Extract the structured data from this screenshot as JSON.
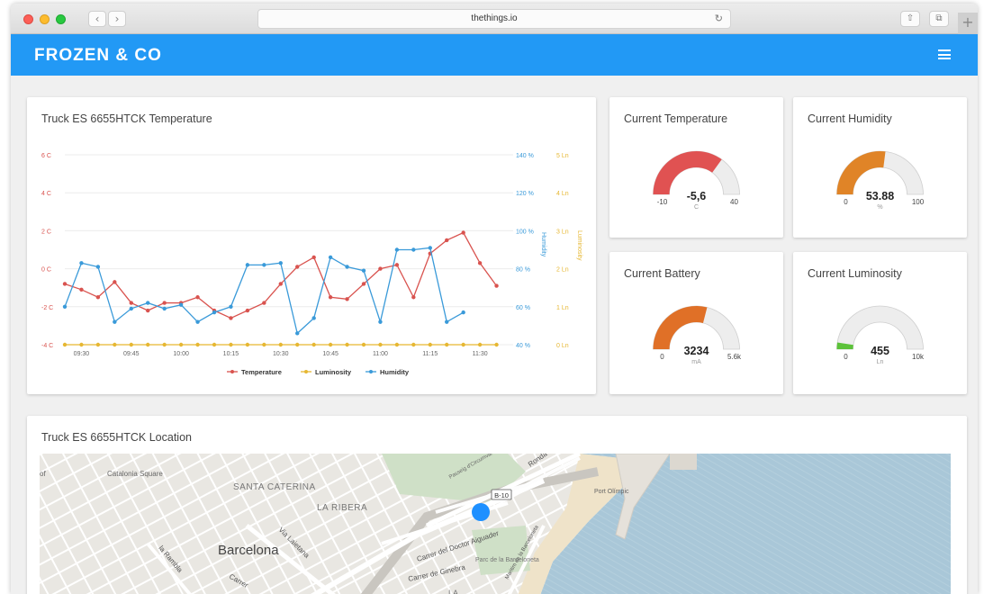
{
  "browser": {
    "url": "thethings.io",
    "back_icon": "‹",
    "forward_icon": "›",
    "reload_icon": "↻",
    "share_icon": "⇧",
    "tabs_icon": "⧉",
    "newtab_icon": "+"
  },
  "app": {
    "brand": "FROZEN & CO",
    "menu_icon": "hamburger-menu-icon",
    "accent_color": "#2299f5"
  },
  "temperature_chart": {
    "title": "Truck ES 6655HTCK Temperature"
  },
  "chart_data": {
    "type": "line",
    "x": [
      "09:25",
      "09:30",
      "09:35",
      "09:40",
      "09:45",
      "09:50",
      "09:55",
      "10:00",
      "10:05",
      "10:10",
      "10:15",
      "10:20",
      "10:25",
      "10:30",
      "10:35",
      "10:40",
      "10:45",
      "10:50",
      "10:55",
      "11:00",
      "11:05",
      "11:10",
      "11:15",
      "11:20",
      "11:25",
      "11:30",
      "11:35",
      "11:40"
    ],
    "x_tick_labels": [
      "09:30",
      "09:45",
      "10:00",
      "10:15",
      "10:30",
      "10:45",
      "11:00",
      "11:15",
      "11:30"
    ],
    "y_left": {
      "ticks": [
        "6 C",
        "4 C",
        "2 C",
        "0 C",
        "-2 C",
        "-4 C"
      ],
      "ylim": [
        -4,
        6
      ]
    },
    "y_right_humidity": {
      "label": "Humidity",
      "ticks": [
        "140 %",
        "120 %",
        "100 %",
        "80 %",
        "60 %",
        "40 %"
      ],
      "ylim": [
        40,
        140
      ]
    },
    "y_right_luminosity": {
      "label": "Luminosity",
      "ticks": [
        "5 Ln",
        "4 Ln",
        "3 Ln",
        "2 Ln",
        "1 Ln",
        "0 Ln"
      ],
      "ylim": [
        0,
        5
      ]
    },
    "series": [
      {
        "name": "Temperature",
        "color": "#d9534f",
        "axis": "left",
        "values": [
          -0.8,
          -1.1,
          -1.5,
          -0.7,
          -1.8,
          -2.2,
          -1.8,
          -1.8,
          -1.5,
          -2.2,
          -2.6,
          -2.2,
          -1.8,
          -0.8,
          0.1,
          0.6,
          -1.5,
          -1.6,
          -0.8,
          0.0,
          0.2,
          -1.5,
          0.8,
          1.5,
          1.9,
          0.3,
          -0.9,
          null
        ]
      },
      {
        "name": "Luminosity",
        "color": "#e6b732",
        "axis": "luminosity",
        "values": [
          0,
          0,
          0,
          0,
          0,
          0,
          0,
          0,
          0,
          0,
          0,
          0,
          0,
          0,
          0,
          0,
          0,
          0,
          0,
          0,
          0,
          0,
          0,
          0,
          0,
          0,
          0,
          null
        ]
      },
      {
        "name": "Humidity",
        "color": "#3a9ad9",
        "axis": "humidity",
        "values": [
          60,
          83,
          81,
          52,
          59,
          62,
          59,
          61,
          52,
          57,
          60,
          82,
          82,
          83,
          46,
          54,
          86,
          81,
          79,
          52,
          90,
          90,
          91,
          52,
          57,
          null,
          null,
          null
        ]
      }
    ],
    "legend": [
      "Temperature",
      "Luminosity",
      "Humidity"
    ]
  },
  "gauges": [
    {
      "title": "Current Temperature",
      "value": "-5,6",
      "unit": "C",
      "min": "-10",
      "max": "40",
      "fraction": 0.7,
      "color": "#e05252"
    },
    {
      "title": "Current Humidity",
      "value": "53.88",
      "unit": "%",
      "min": "0",
      "max": "100",
      "fraction": 0.54,
      "color": "#e08427"
    },
    {
      "title": "Current Battery",
      "value": "3234",
      "unit": "mA",
      "min": "0",
      "max": "5.6k",
      "fraction": 0.58,
      "color": "#e07027"
    },
    {
      "title": "Current Luminosity",
      "value": "455",
      "unit": "Ln",
      "min": "0",
      "max": "10k",
      "fraction": 0.05,
      "color": "#5cc23a"
    }
  ],
  "location": {
    "title": "Truck ES 6655HTCK Location",
    "labels": {
      "catalonia_square": "Catalonia Square",
      "santa_caterina": "SANTA CATERINA",
      "la_ribera": "LA RIBERA",
      "barcelona": "Barcelona",
      "via_laietana": "Via Laietana",
      "la_rambla": "la Rambla",
      "carrer": "Carrer",
      "carrer_doctor": "Carrer del Doctor Aiguader",
      "carrer_ginebra": "Carrer de Ginebra",
      "parc_barceloneta": "Parc de la Barceloneta",
      "port_olimpic": "Port Olímpic",
      "ronda": "Ronda",
      "b10": "B-10",
      "passeig": "Passeig d'Circumval·lació",
      "maritim": "Maritim de la Barceloneta",
      "la": "LA",
      "of": "of"
    }
  }
}
